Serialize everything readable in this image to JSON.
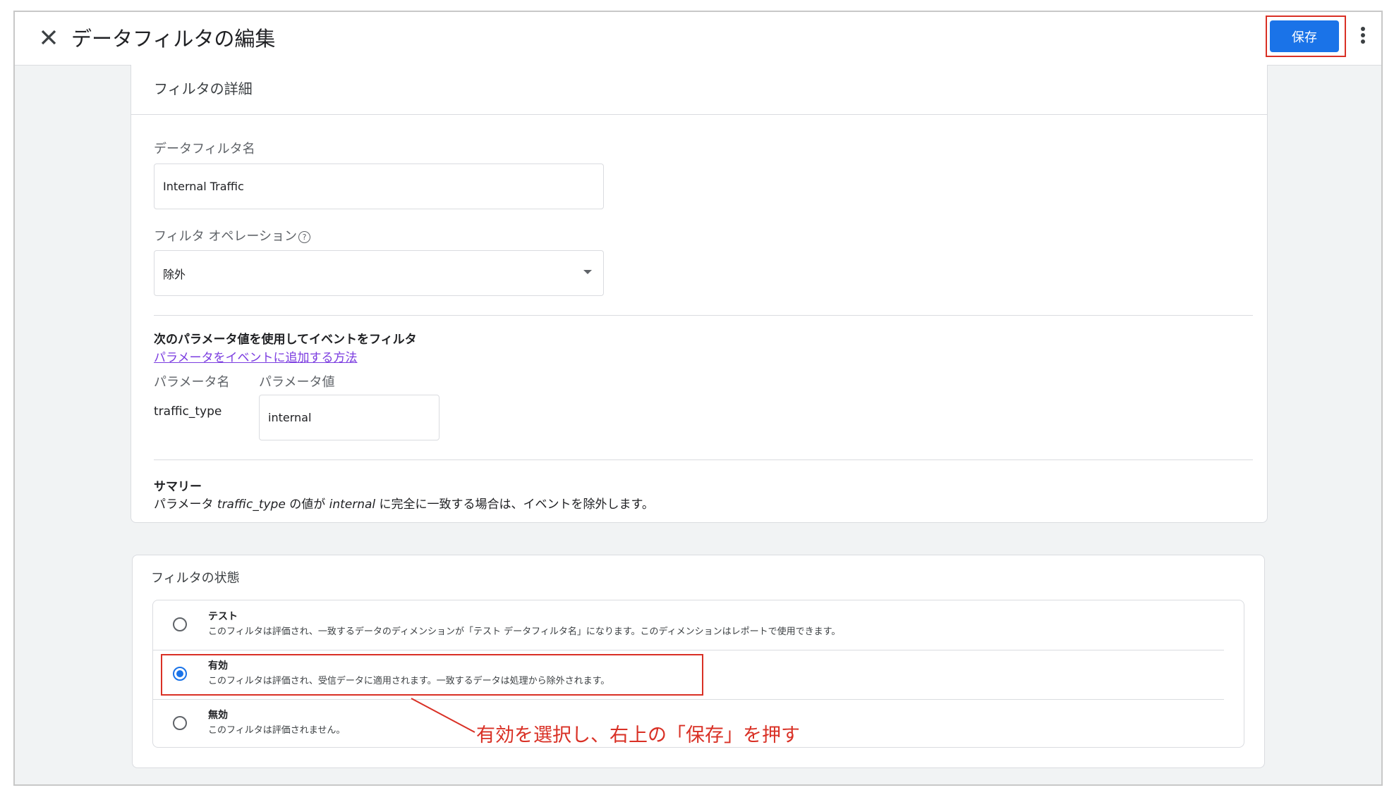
{
  "header": {
    "title": "データフィルタの編集",
    "save_label": "保存",
    "close_icon": "close-icon",
    "more_icon": "more-vert-icon"
  },
  "details": {
    "heading": "フィルタの詳細",
    "name_label": "データフィルタ名",
    "name_value": "Internal Traffic",
    "operation_label": "フィルタ オペレーション",
    "operation_value": "除外",
    "param_heading": "次のパラメータ値を使用してイベントをフィルタ",
    "param_link": "パラメータをイベントに追加する方法",
    "param_name_header": "パラメータ名",
    "param_value_header": "パラメータ値",
    "param_name": "traffic_type",
    "param_value": "internal",
    "summary_heading": "サマリー",
    "summary_prefix": "パラメータ ",
    "summary_param": "traffic_type",
    "summary_mid": " の値が ",
    "summary_value": "internal",
    "summary_suffix": " に完全に一致する場合は、イベントを除外します。"
  },
  "state": {
    "heading": "フィルタの状態",
    "options": [
      {
        "title": "テスト",
        "desc": "このフィルタは評価され、一致するデータのディメンションが「テスト データフィルタ名」になります。このディメンションはレポートで使用できます。",
        "selected": false
      },
      {
        "title": "有効",
        "desc": "このフィルタは評価され、受信データに適用されます。一致するデータは処理から除外されます。",
        "selected": true
      },
      {
        "title": "無効",
        "desc": "このフィルタは評価されません。",
        "selected": false
      }
    ]
  },
  "annotation": "有効を選択し、右上の「保存」を押す",
  "colors": {
    "accent": "#1a73e8",
    "highlight": "#d93025",
    "link": "#7b3ce0"
  }
}
